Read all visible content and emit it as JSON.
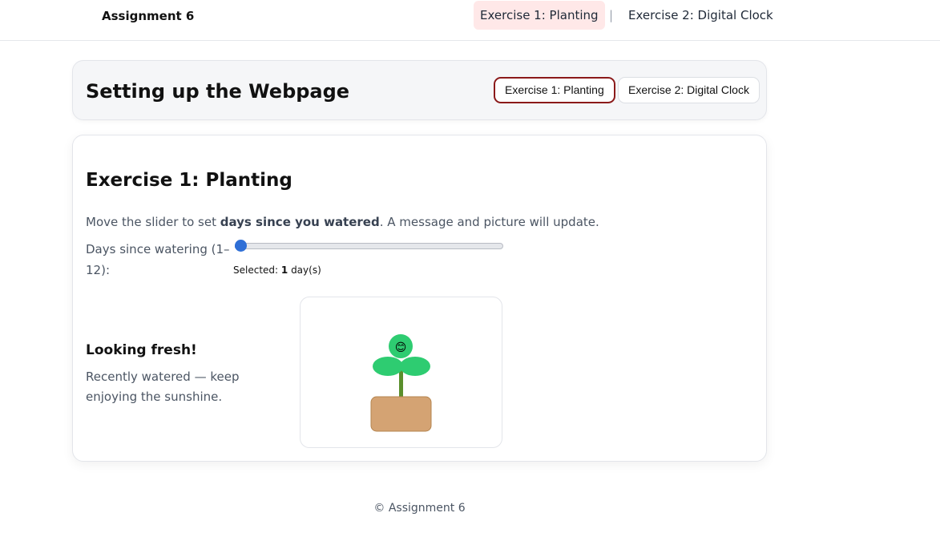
{
  "nav": {
    "brand": "Assignment 6",
    "links": [
      {
        "label": "Exercise 1: Planting",
        "active": true
      },
      {
        "label": "Exercise 2: Digital Clock",
        "active": false
      }
    ],
    "separator": "|"
  },
  "header": {
    "title": "Setting up the Webpage",
    "buttons": [
      {
        "label": "Exercise 1: Planting",
        "selected": true
      },
      {
        "label": "Exercise 2: Digital Clock",
        "selected": false
      }
    ]
  },
  "exercise": {
    "title": "Exercise 1: Planting",
    "description_prefix": "Move the slider to set ",
    "description_bold": "days since you watered",
    "description_suffix": ". A message and picture will update.",
    "slider_label": "Days since watering (1–12):",
    "slider": {
      "min": 1,
      "max": 12,
      "value": 1
    },
    "selected_prefix": "Selected: ",
    "selected_value": "1",
    "selected_suffix": " day(s)",
    "status_title": "Looking fresh!",
    "status_desc": "Recently watered — keep enjoying the sunshine.",
    "plant": {
      "face": "😊",
      "leaf_color": "#2ecc71",
      "stem_color": "#5a8f2c",
      "pot_color": "#d4a373"
    }
  },
  "footer": {
    "text": "© Assignment 6"
  },
  "colors": {
    "accent": "#2f6fd6",
    "active_nav_bg": "#ffe8e8",
    "active_button_border": "#8b1a1a"
  }
}
